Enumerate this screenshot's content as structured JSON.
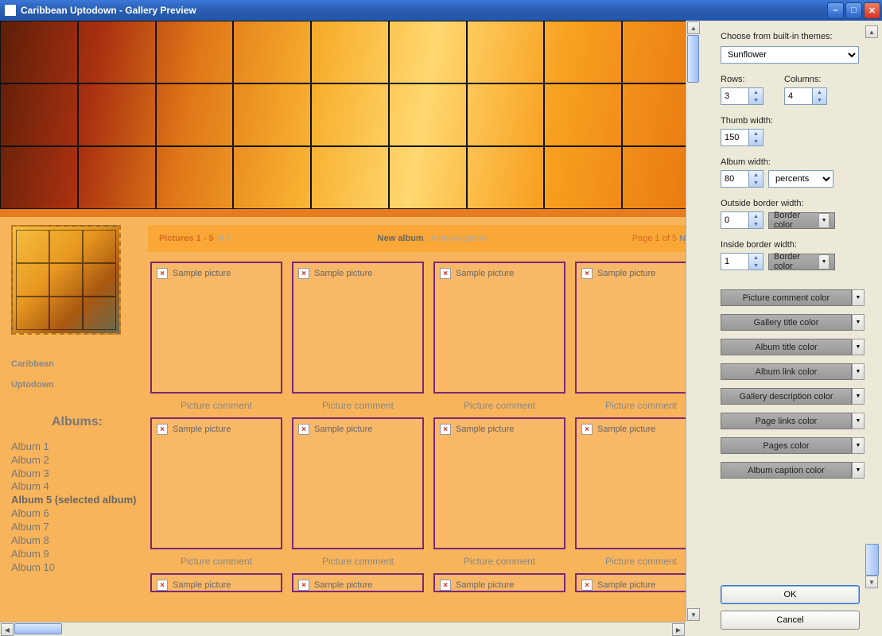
{
  "window": {
    "title": "Caribbean Uptodown - Gallery Preview"
  },
  "preview": {
    "brand_line1": "Caribbean",
    "brand_line2": "Uptodown",
    "albums_heading": "Albums:",
    "albums": [
      "Album 1",
      "Album 2",
      "Album 3",
      "Album 4",
      "Album 5 (selected album)",
      "Album 6",
      "Album 7",
      "Album 8",
      "Album 9",
      "Album 10"
    ],
    "selected_index": 4,
    "pager": {
      "pictures_range": "Pictures 1 - 5",
      "of_total": "of 5",
      "new_album_label": "New album",
      "album_caption": "Album caption",
      "page_text": "Page 1 of 5",
      "next": "Next"
    },
    "tile_label": "Sample picture",
    "tile_caption": "Picture comment"
  },
  "panel": {
    "theme_label": "Choose from built-in themes:",
    "theme_value": "Sunflower",
    "rows_label": "Rows:",
    "rows_value": "3",
    "cols_label": "Columns:",
    "cols_value": "4",
    "thumb_width_label": "Thumb width:",
    "thumb_width_value": "150",
    "album_width_label": "Album width:",
    "album_width_value": "80",
    "album_width_unit": "percents",
    "outside_border_label": "Outside border width:",
    "outside_border_value": "0",
    "inside_border_label": "Inside border width:",
    "inside_border_value": "1",
    "border_color_label": "Border color",
    "color_buttons": [
      "Picture comment color",
      "Gallery title color",
      "Album title color",
      "Album link color",
      "Gallery description color",
      "Page links color",
      "Pages color",
      "Album caption color"
    ],
    "ok": "OK",
    "cancel": "Cancel"
  }
}
